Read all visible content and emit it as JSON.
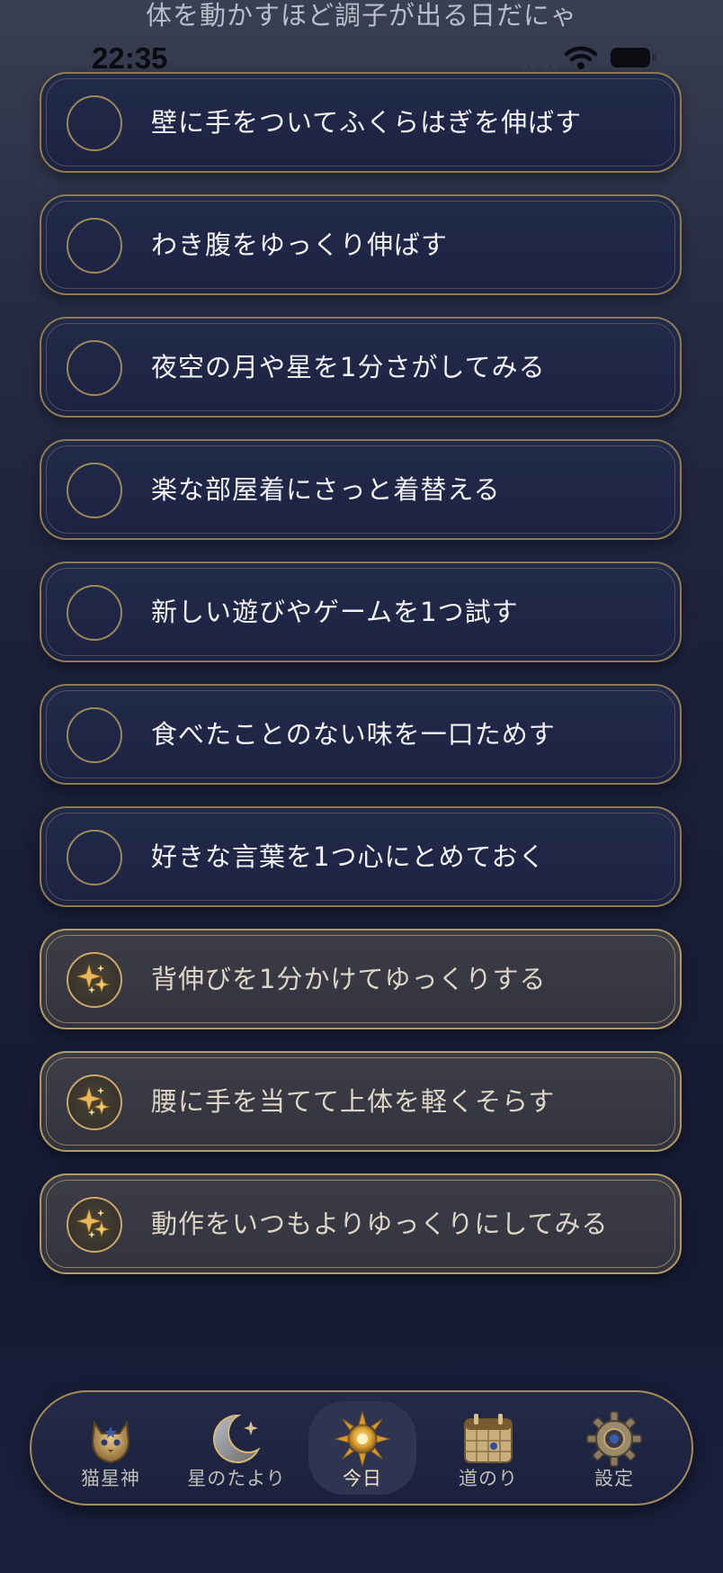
{
  "header": {
    "message": "体を動かすほど調子が出る日だにゃ"
  },
  "status_bar": {
    "time": "22:35"
  },
  "tasks": [
    {
      "label": "壁に手をついてふくらはぎを伸ばす",
      "done": false
    },
    {
      "label": "わき腹をゆっくり伸ばす",
      "done": false
    },
    {
      "label": "夜空の月や星を1分さがしてみる",
      "done": false
    },
    {
      "label": "楽な部屋着にさっと着替える",
      "done": false
    },
    {
      "label": "新しい遊びやゲームを1つ試す",
      "done": false
    },
    {
      "label": "食べたことのない味を一口ためす",
      "done": false
    },
    {
      "label": "好きな言葉を1つ心にとめておく",
      "done": false
    },
    {
      "label": "背伸びを1分かけてゆっくりする",
      "done": true
    },
    {
      "label": "腰に手を当てて上体を軽くそらす",
      "done": true
    },
    {
      "label": "動作をいつもよりゆっくりにしてみる",
      "done": true
    }
  ],
  "tab_bar": {
    "items": [
      {
        "label": "猫星神",
        "icon": "cat-god-icon"
      },
      {
        "label": "星のたより",
        "icon": "crescent-moon-icon"
      },
      {
        "label": "今日",
        "icon": "sun-icon",
        "active": true
      },
      {
        "label": "道のり",
        "icon": "calendar-icon"
      },
      {
        "label": "設定",
        "icon": "gear-icon"
      }
    ]
  },
  "colors": {
    "gold": "#c9a865",
    "navy": "#1c2242",
    "done_bg": "#38383f"
  }
}
